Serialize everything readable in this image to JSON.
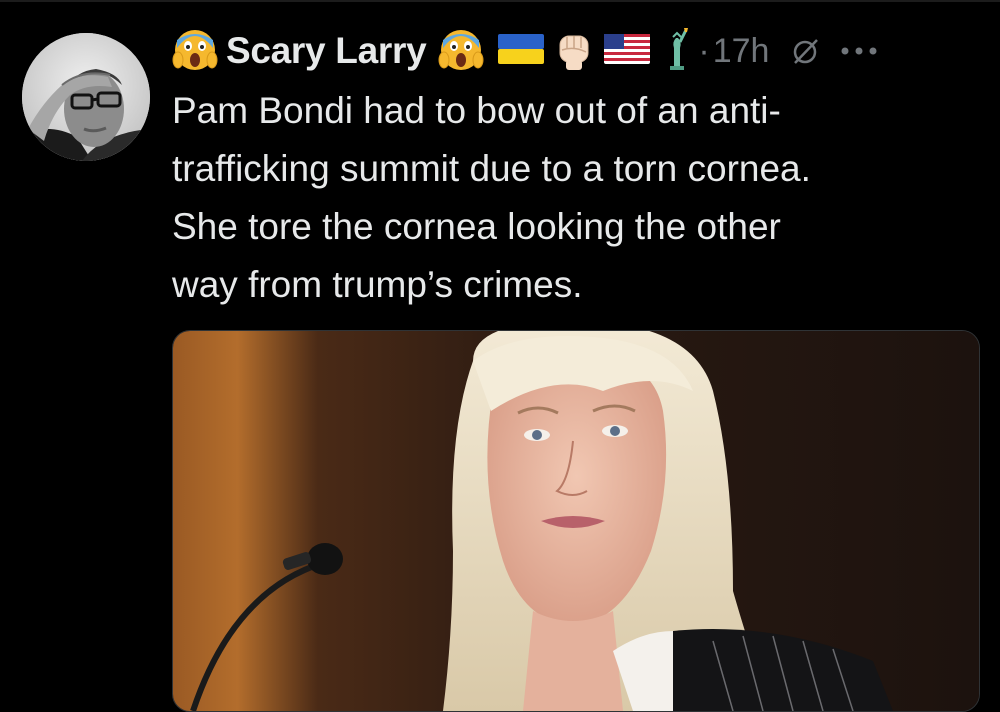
{
  "tweet": {
    "author": {
      "display_name": "Scary Larry",
      "name_emoji_left": "😱",
      "name_emoji_right": "😱",
      "badges": [
        "ukraine-flag",
        "raised-fist-light-skin",
        "us-flag",
        "statue-of-liberty"
      ]
    },
    "separator": "·",
    "timestamp": "17h",
    "text_lines": [
      "Pam Bondi had to bow out of an anti-",
      "trafficking summit due to a torn cornea.",
      "She tore the cornea looking the other",
      "way from trump’s crimes."
    ],
    "icons": {
      "grok": "grok-icon",
      "more": "more-options-icon"
    },
    "media": {
      "kind": "photo"
    }
  },
  "colors": {
    "background": "#000000",
    "text_primary": "#e7e9ea",
    "text_secondary": "#71767b",
    "border": "#2f3336"
  }
}
